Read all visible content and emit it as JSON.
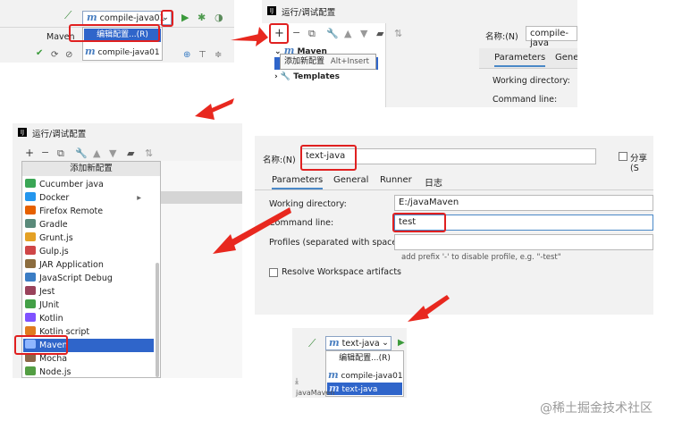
{
  "panel1": {
    "config_selected": "compile-java01",
    "maven_tab": "Maven",
    "menu": {
      "edit": "编辑配置...(R)",
      "item": "compile-java01"
    }
  },
  "panel2": {
    "window_title": "运行/调试配置",
    "tree": {
      "maven": "Maven",
      "templates": "Templates"
    },
    "tooltip": {
      "label": "添加新配置",
      "shortcut": "Alt+Insert"
    },
    "name_label": "名称:(N)",
    "name_value": "compile-java",
    "tabs": [
      "Parameters",
      "Gene"
    ],
    "working_dir_label": "Working directory:",
    "command_line_label": "Command line:"
  },
  "panel3": {
    "window_title": "运行/调试配置",
    "dropdown_header": "添加新配置",
    "items": [
      {
        "label": "Cucumber java",
        "color": "#3aa655"
      },
      {
        "label": "Docker",
        "color": "#2496ed"
      },
      {
        "label": "Firefox Remote",
        "color": "#e66000"
      },
      {
        "label": "Gradle",
        "color": "#5a8a7a"
      },
      {
        "label": "Grunt.js",
        "color": "#e4a125"
      },
      {
        "label": "Gulp.js",
        "color": "#cf4647"
      },
      {
        "label": "JAR Application",
        "color": "#8c6d3f"
      },
      {
        "label": "JavaScript Debug",
        "color": "#3b7dc4"
      },
      {
        "label": "Jest",
        "color": "#99425b"
      },
      {
        "label": "JUnit",
        "color": "#43a047"
      },
      {
        "label": "Kotlin",
        "color": "#7f52ff"
      },
      {
        "label": "Kotlin script",
        "color": "#e07b1f"
      },
      {
        "label": "Maven",
        "color": "#4a7fc1"
      },
      {
        "label": "Mocha",
        "color": "#8d6748"
      },
      {
        "label": "Node.js",
        "color": "#539e43"
      }
    ]
  },
  "panel4": {
    "name_label": "名称:(N)",
    "name_value": "text-java",
    "share_label": "分享(S",
    "tabs": [
      "Parameters",
      "General",
      "Runner",
      "日志"
    ],
    "working_dir_label": "Working directory:",
    "working_dir_value": "E:/javaMaven",
    "command_line_label": "Command line:",
    "command_line_value": "test",
    "profiles_label": "Profiles (separated with space):",
    "profiles_hint": "add prefix '-' to disable profile, e.g. \"-test\"",
    "resolve_label": "Resolve Workspace artifacts"
  },
  "panel5": {
    "config_selected": "text-java",
    "menu": {
      "edit": "编辑配置...(R)",
      "items": [
        "compile-java01",
        "text-java"
      ]
    },
    "partial_text": "javaMaven"
  },
  "watermark": "@稀土掘金技术社区"
}
